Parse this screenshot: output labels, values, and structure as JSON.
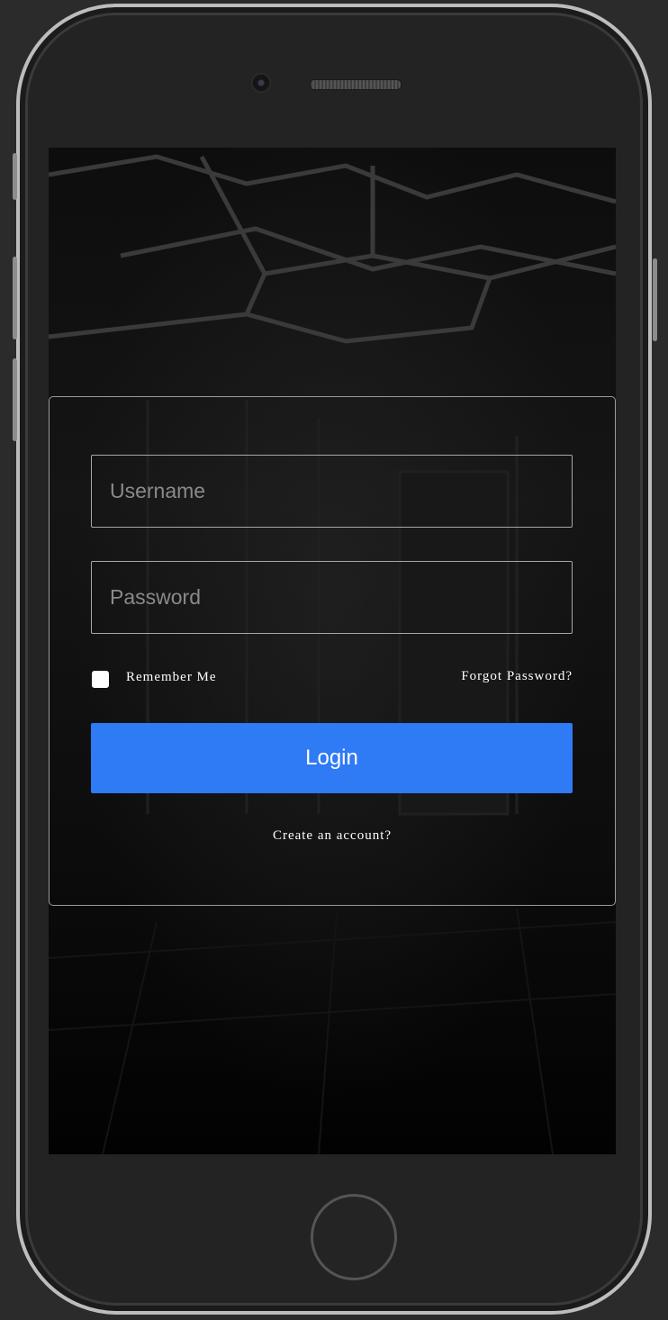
{
  "login_form": {
    "username_placeholder": "Username",
    "password_placeholder": "Password",
    "remember_label": "Remember Me",
    "forgot_label": "Forgot Password?",
    "login_label": "Login",
    "create_label": "Create an account?"
  },
  "colors": {
    "accent": "#2f7af5",
    "background": "#000000",
    "device_frame": "#232323"
  },
  "icons": {
    "checkbox": "checkbox-icon"
  }
}
